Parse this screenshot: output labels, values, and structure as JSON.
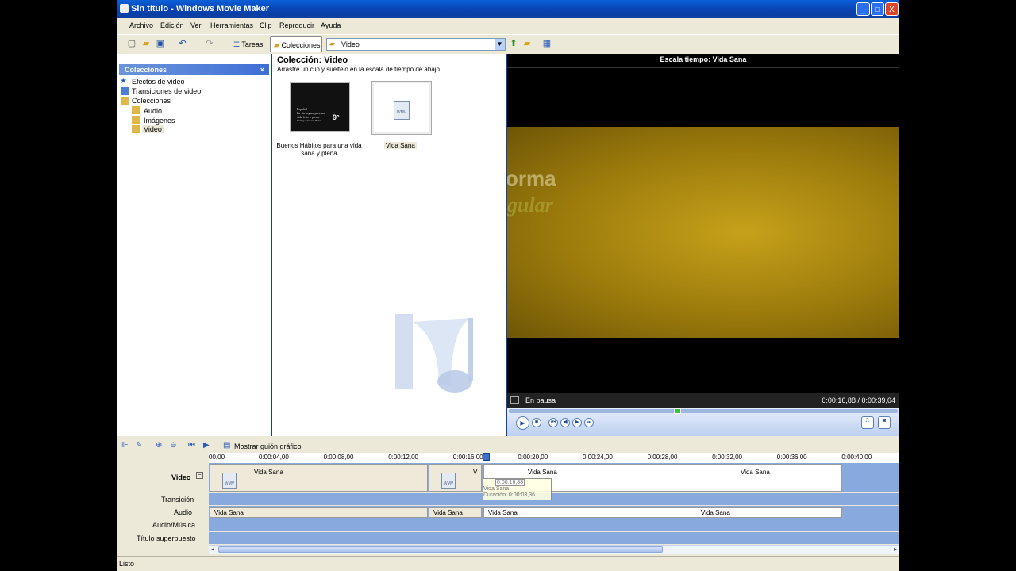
{
  "window": {
    "title": "Sin título - Windows Movie Maker",
    "min": "_",
    "max": "□",
    "close": "X"
  },
  "menu": [
    "Archivo",
    "Edición",
    "Ver",
    "Herramientas",
    "Clip",
    "Reproducir",
    "Ayuda"
  ],
  "toolbar": {
    "tareas": "Tareas",
    "colecciones": "Colecciones",
    "combo_value": "Video"
  },
  "collections_pane": {
    "title": "Colecciones",
    "close": "×",
    "items": [
      "Efectos de video",
      "Transiciones de video",
      "Colecciones",
      "Audio",
      "Imágenes",
      "Video"
    ]
  },
  "collection_view": {
    "title": "Colección: Video",
    "subtitle": "Arrastre un clip y suéltelo en la escala de tiempo de abajo.",
    "clips": [
      {
        "label": "Buenos Hábitos para una vida sana y plena",
        "thumb_text": [
          "Español",
          "La vía segura para una",
          "vida feliz y plena.",
          "9°",
          "Santiago Chaparro Huisa"
        ]
      },
      {
        "label": "Vida Sana",
        "badge": "WMV"
      }
    ]
  },
  "preview": {
    "title": "Escala tiempo: Vida Sana",
    "overlay_text": [
      "orma",
      "gular"
    ],
    "status": "En pausa",
    "time": "0:00:16,88 / 0:00:39,04",
    "progress_fraction": 0.432
  },
  "timeline": {
    "show_storyboard": "Mostrar guión gráfico",
    "ruler": [
      "00,00",
      "0:00:04,00",
      "0:00:08,00",
      "0:00:12,00",
      "0:00:16,00",
      "0:00:20,00",
      "0:00:24,00",
      "0:00:28,00",
      "0:00:32,00",
      "0:00:36,00",
      "0:00:40,00"
    ],
    "tracks": {
      "video": "Video",
      "video_toggle": "⊟",
      "transition": "Transición",
      "audio": "Audio",
      "audio_music": "Audio/Música",
      "title_overlay": "Título superpuesto"
    },
    "video_clips": [
      {
        "label": "Vida Sana",
        "badge": "WMV"
      },
      {
        "label": "V",
        "badge": "WMV"
      },
      {
        "label": "Vida Sana"
      },
      {
        "label": "Vida Sana"
      }
    ],
    "audio_clips": [
      "Vida Sana",
      "Vida Sana",
      "Vida Sana",
      "Vida Sana"
    ],
    "tooltip": {
      "time": "0:00:16,88",
      "name": "Vida Sana",
      "duration": "Duración: 0:00:03,36"
    }
  },
  "status": "Listo"
}
